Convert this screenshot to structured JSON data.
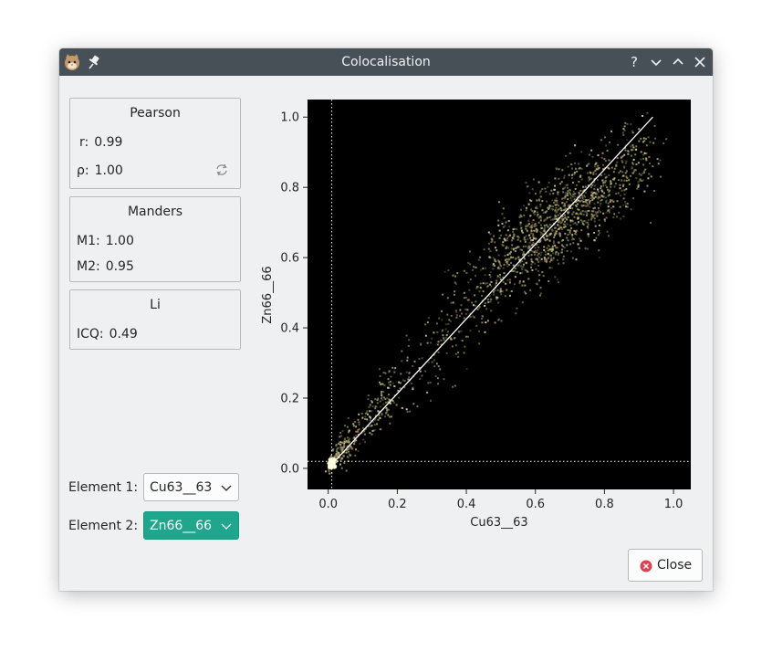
{
  "window": {
    "title": "Colocalisation",
    "icons": [
      "cat-app-icon",
      "pin-icon",
      "help-icon",
      "minimize-icon",
      "maximize-icon",
      "close-icon"
    ]
  },
  "pearson": {
    "title": "Pearson",
    "r_label": "r:",
    "r_value": "0.99",
    "rho_label": "ρ:",
    "rho_value": "1.00",
    "refresh_icon": "refresh-icon"
  },
  "manders": {
    "title": "Manders",
    "m1_label": "M1:",
    "m1_value": "1.00",
    "m2_label": "M2:",
    "m2_value": "0.95"
  },
  "li": {
    "title": "Li",
    "icq_label": "ICQ:",
    "icq_value": "0.49"
  },
  "element1": {
    "label": "Element 1:",
    "value": "Cu63__63"
  },
  "element2": {
    "label": "Element 2:",
    "value": "Zn66__66"
  },
  "close_button": {
    "label": "Close",
    "icon": "close-circle-icon"
  },
  "colors": {
    "accent": "#1fa78d",
    "titlebar": "#475057",
    "plot_bg": "#000000"
  },
  "chart_data": {
    "type": "scatter",
    "xlabel": "Cu63__63",
    "ylabel": "Zn66__66",
    "xlim": [
      -0.06,
      1.05
    ],
    "ylim": [
      -0.06,
      1.05
    ],
    "xticks": [
      "0.0",
      "0.2",
      "0.4",
      "0.6",
      "0.8",
      "1.0"
    ],
    "yticks": [
      "0.0",
      "0.2",
      "0.4",
      "0.6",
      "0.8",
      "1.0"
    ],
    "xtick_values": [
      0,
      0.2,
      0.4,
      0.6,
      0.8,
      1.0
    ],
    "ytick_values": [
      0,
      0.2,
      0.4,
      0.6,
      0.8,
      1.0
    ],
    "threshold_x": 0.01,
    "threshold_y": 0.02,
    "fit_line": {
      "x": [
        0.0,
        0.94
      ],
      "y": [
        0.0,
        1.0
      ]
    },
    "cloud": {
      "x": [
        0.0,
        0.02,
        0.05,
        0.1,
        0.15,
        0.2,
        0.3,
        0.4,
        0.5,
        0.55,
        0.6,
        0.65,
        0.7,
        0.75,
        0.8,
        0.85,
        0.9
      ],
      "y": [
        0.0,
        0.03,
        0.07,
        0.13,
        0.18,
        0.22,
        0.34,
        0.46,
        0.56,
        0.62,
        0.66,
        0.7,
        0.74,
        0.77,
        0.8,
        0.86,
        0.9
      ],
      "spread": [
        0.01,
        0.02,
        0.03,
        0.04,
        0.05,
        0.06,
        0.07,
        0.08,
        0.08,
        0.08,
        0.08,
        0.08,
        0.08,
        0.08,
        0.08,
        0.07,
        0.06
      ],
      "density": [
        60,
        80,
        60,
        60,
        60,
        60,
        80,
        100,
        130,
        160,
        180,
        180,
        160,
        130,
        100,
        70,
        40
      ]
    }
  }
}
